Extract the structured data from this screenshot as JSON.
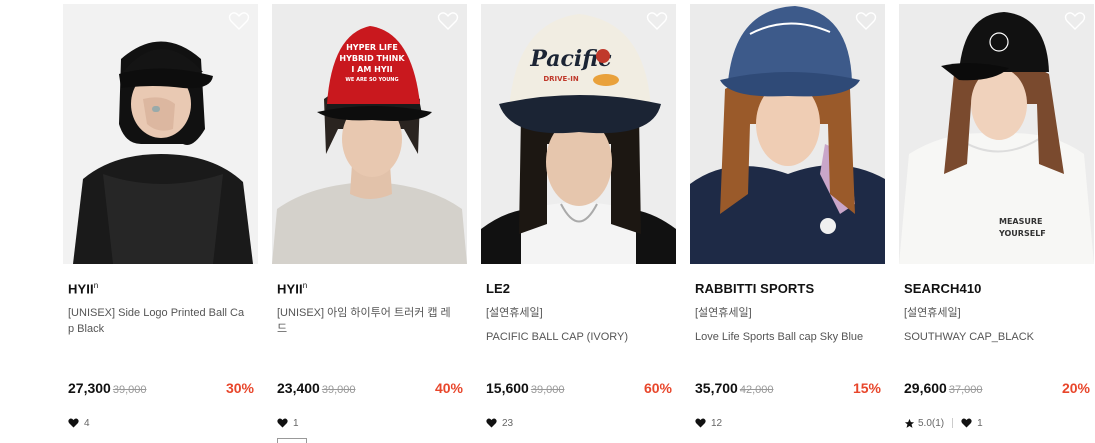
{
  "products": [
    {
      "brand": "HYII",
      "brand_sup": "n",
      "name": "[UNISEX] Side Logo Printed Ball Ca",
      "name_line2": "p Black",
      "price": "27,300",
      "original_price": "39,000",
      "discount": "30%",
      "likes": "4",
      "image_icon": "person-black-cap-photo"
    },
    {
      "brand": "HYII",
      "brand_sup": "n",
      "name": "[UNISEX] 아임 하이투어 트러커 캡 레",
      "name_line2": "드",
      "price": "23,400",
      "original_price": "39,000",
      "discount": "40%",
      "likes": "1",
      "image_icon": "person-red-trucker-cap-photo",
      "cap_text": [
        "HYPER LIFE",
        "HYBRID THINK",
        "I AM HYII",
        "WE ARE SO YOUNG"
      ]
    },
    {
      "brand": "LE2",
      "tag": "[설연휴세일]",
      "name": "PACIFIC BALL CAP (IVORY)",
      "price": "15,600",
      "original_price": "39,000",
      "discount": "60%",
      "likes": "23",
      "image_icon": "person-pacific-cap-photo",
      "cap_text": [
        "Pacific",
        "DRIVE-IN"
      ]
    },
    {
      "brand": "RABBITTI SPORTS",
      "tag": "[설연휴세일]",
      "name": "Love Life Sports Ball cap Sky Blue",
      "price": "35,700",
      "original_price": "42,000",
      "discount": "15%",
      "likes": "12",
      "image_icon": "person-blue-cap-photo"
    },
    {
      "brand": "SEARCH410",
      "tag": "[설연휴세일]",
      "name": "SOUTHWAY CAP_BLACK",
      "price": "29,600",
      "original_price": "37,000",
      "discount": "20%",
      "rating": "5.0(1)",
      "likes": "1",
      "image_icon": "person-black-cap-hoodie-photo",
      "hoodie_text": [
        "MEASURE",
        "YOURSELF"
      ]
    }
  ],
  "colors": {
    "discount": "#e8462b",
    "text_primary": "#111111",
    "text_secondary": "#555555",
    "strikethrough": "#999999"
  }
}
